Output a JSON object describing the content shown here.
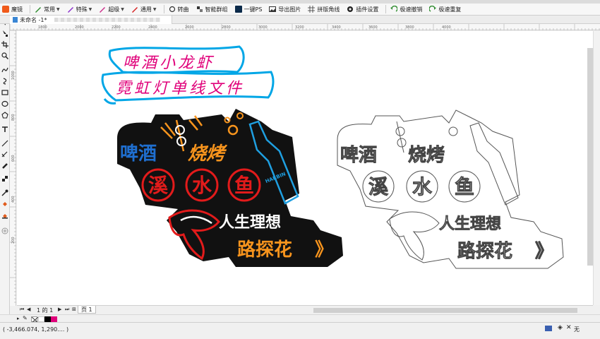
{
  "app": {
    "title": "魔镜"
  },
  "toolbar": {
    "items": [
      {
        "label": "常用",
        "icon": "pen-icon"
      },
      {
        "label": "特殊",
        "icon": "pen-icon"
      },
      {
        "label": "超级",
        "icon": "pen-icon"
      },
      {
        "label": "通用",
        "icon": "pen-icon"
      },
      {
        "label": "转曲",
        "icon": "transform-icon"
      },
      {
        "label": "智能群组",
        "icon": "group-icon"
      },
      {
        "label": "一键PS",
        "icon": "ps-icon"
      },
      {
        "label": "导出图片",
        "icon": "image-icon"
      },
      {
        "label": "拼版角线",
        "icon": "crop-marks-icon"
      },
      {
        "label": "插件设置",
        "icon": "gear-icon"
      },
      {
        "label": "极速撤销",
        "icon": "undo-icon"
      },
      {
        "label": "极速重复",
        "icon": "redo-icon"
      }
    ]
  },
  "document": {
    "tab_label": "未命名 -1*"
  },
  "ruler": {
    "h_labels": [
      "1800",
      "2000",
      "2200",
      "2400",
      "2600",
      "2800",
      "3000",
      "3200",
      "3400",
      "3600",
      "3800",
      "4000"
    ],
    "v_labels": [
      "1000",
      "800",
      "600",
      "400",
      "200"
    ]
  },
  "artwork": {
    "title_line1": "啤酒小龙虾",
    "title_line2": "霓虹灯单线文件",
    "sign_line1a": "啤酒",
    "sign_line1b": "烧烤",
    "sign_chars": [
      "溪",
      "水",
      "鱼"
    ],
    "sign_line3": "人生理想",
    "sign_line4": "路探花",
    "chevrons": "》",
    "bottle_text": "HARBIN"
  },
  "pagebar": {
    "page_counter": "1 的 1",
    "page_tab": "页 1"
  },
  "status": {
    "coords": "( -3,466.074, 1,290.... )",
    "fill_label": "无"
  },
  "colors": {
    "neon_blue": "#1f6fd0",
    "neon_red": "#e21b1b",
    "neon_orange": "#f7941d",
    "neon_white": "#ffffff",
    "brush_magenta": "#e0007a",
    "brush_cyan": "#00a6e6"
  }
}
